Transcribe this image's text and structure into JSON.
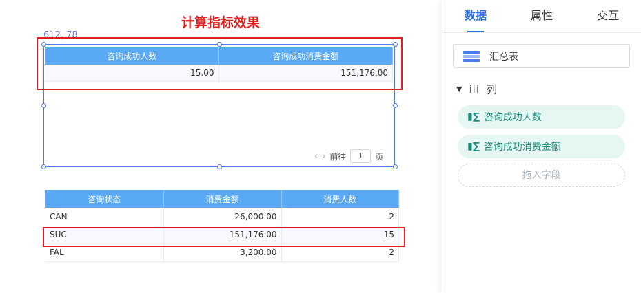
{
  "page": {
    "title": "计算指标效果",
    "coord_label": "612, 78"
  },
  "table1": {
    "headers": [
      "咨询成功人数",
      "咨询成功消费金额"
    ],
    "row": [
      "15.00",
      "151,176.00"
    ]
  },
  "pager": {
    "prev": "‹",
    "next": "›",
    "goto_label": "前往",
    "page_value": "1",
    "page_suffix": "页"
  },
  "table2": {
    "headers": [
      "咨询状态",
      "消费金额",
      "消费人数"
    ],
    "rows": [
      [
        "CAN",
        "26,000.00",
        "2"
      ],
      [
        "SUC",
        "151,176.00",
        "15"
      ],
      [
        "FAL",
        "3,200.00",
        "2"
      ]
    ]
  },
  "panel": {
    "tabs": [
      "数据",
      "属性",
      "交互"
    ],
    "summary_label": "汇总表",
    "columns_label": "列",
    "column_glyph": "iii",
    "fields": [
      "咨询成功人数",
      "咨询成功消费金额"
    ],
    "field_icon": "▮∑",
    "drop_placeholder": "拖入字段"
  },
  "colors": {
    "accent": "#2c6fe0",
    "highlight": "#e02020",
    "header_bg": "#5aa9f5",
    "field_bg": "#e6f6f3"
  }
}
